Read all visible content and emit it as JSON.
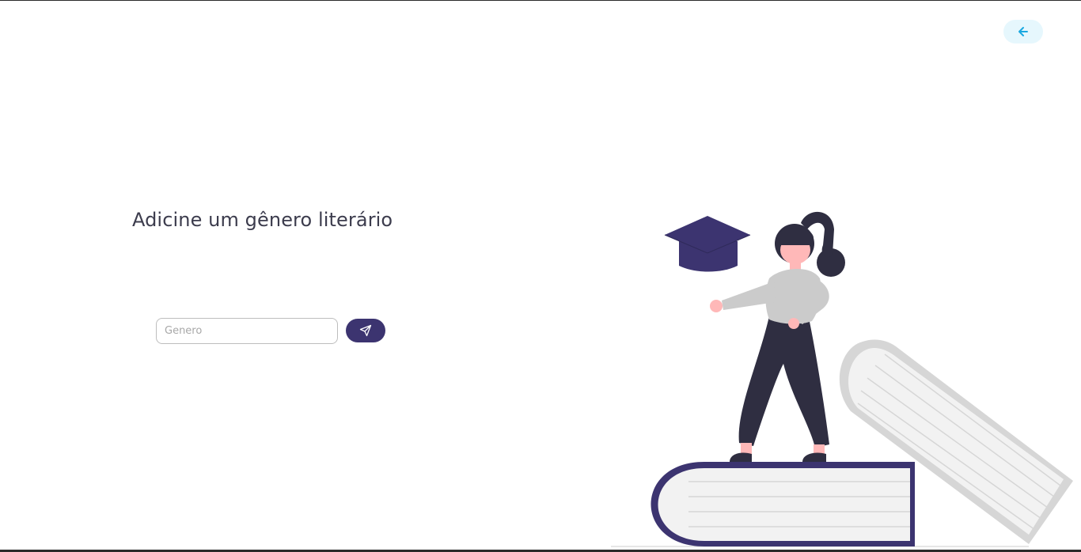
{
  "header": {
    "back_button_label": "",
    "back_icon": "arrow-left-icon"
  },
  "main": {
    "title": "Adicine um gênero literário",
    "genre_input": {
      "value": "",
      "placeholder": "Genero"
    },
    "submit_button_label": "",
    "submit_icon": "send-icon"
  },
  "illustration": {
    "subject": "woman-standing-on-books-illustration"
  },
  "colors": {
    "accent": "#3c3470",
    "back_button_bg": "#e6f7fd",
    "back_icon": "#1aa8e0",
    "title_text": "#3c3c4d",
    "border": "#2b2b2b"
  }
}
